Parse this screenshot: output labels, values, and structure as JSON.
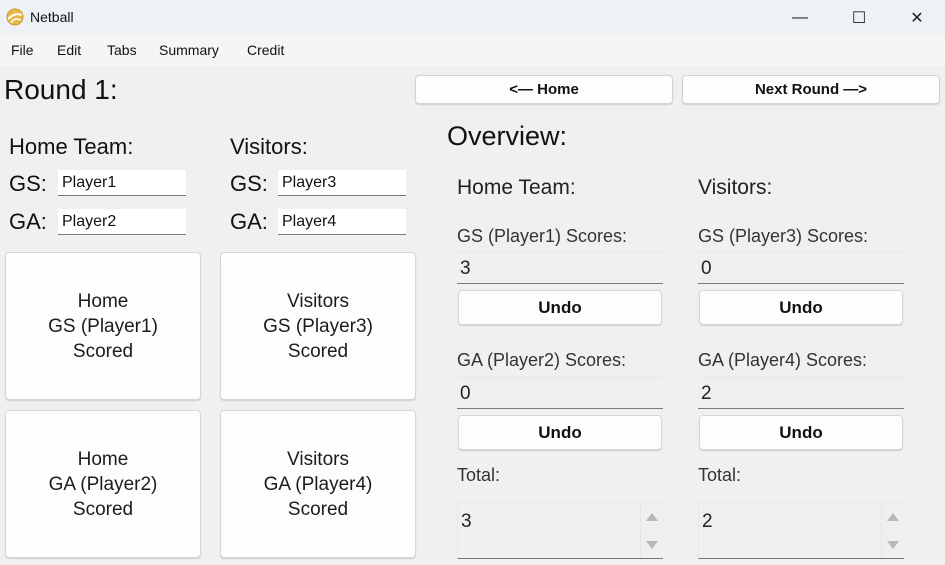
{
  "window": {
    "title": "Netball",
    "minimize_glyph": "—",
    "maximize_glyph": "☐",
    "close_glyph": "✕"
  },
  "menu": [
    "File",
    "Edit",
    "Tabs",
    "Summary",
    "Credit"
  ],
  "round": {
    "title": "Round 1:"
  },
  "nav": {
    "home_label": "<— Home",
    "next_label": "Next Round —>"
  },
  "setup": {
    "home": {
      "heading": "Home Team:",
      "gs_label": "GS:",
      "gs_value": "Player1",
      "ga_label": "GA:",
      "ga_value": "Player2"
    },
    "visitors": {
      "heading": "Visitors:",
      "gs_label": "GS:",
      "gs_value": "Player3",
      "ga_label": "GA:",
      "ga_value": "Player4"
    }
  },
  "score_buttons": {
    "home_gs": "Home\nGS (Player1)\nScored",
    "visitors_gs": "Visitors\nGS (Player3)\nScored",
    "home_ga": "Home\nGA (Player2)\nScored",
    "visitors_ga": "Visitors\nGA (Player4)\nScored"
  },
  "overview": {
    "title": "Overview:",
    "undo_label": "Undo",
    "home": {
      "heading": "Home Team:",
      "gs_label": "GS (Player1) Scores:",
      "gs_score": "3",
      "ga_label": "GA (Player2) Scores:",
      "ga_score": "0",
      "total_label": "Total:",
      "total": "3"
    },
    "visitors": {
      "heading": "Visitors:",
      "gs_label": "GS (Player3) Scores:",
      "gs_score": "0",
      "ga_label": "GA (Player4) Scores:",
      "ga_score": "2",
      "total_label": "Total:",
      "total": "2"
    }
  }
}
